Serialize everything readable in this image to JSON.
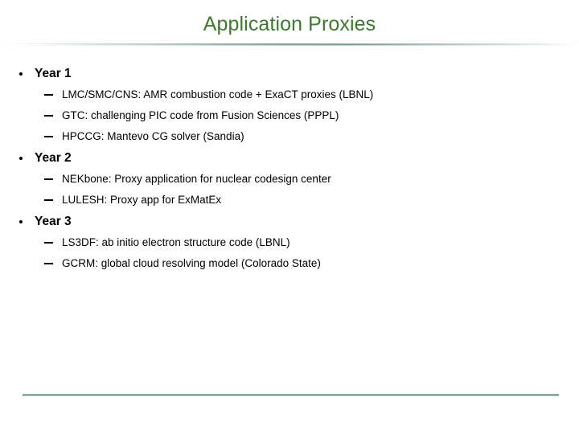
{
  "slide": {
    "title": "Application Proxies",
    "title_color": "#3C7A2E",
    "rule_color": "#3F6E63",
    "background_color": "#FFFFFF",
    "text_color": "#000000"
  },
  "content": {
    "groups": [
      {
        "heading": "Year 1",
        "items": [
          "LMC/SMC/CNS: AMR combustion code + ExaCT proxies (LBNL)",
          "GTC: challenging PIC code from Fusion Sciences (PPPL)",
          "HPCCG: Mantevo CG solver (Sandia)"
        ]
      },
      {
        "heading": "Year 2",
        "items": [
          "NEKbone: Proxy application for nuclear codesign center",
          "LULESH: Proxy app for ExMatEx"
        ]
      },
      {
        "heading": "Year 3",
        "items": [
          "LS3DF: ab initio electron structure code (LBNL)",
          "GCRM: global cloud resolving model (Colorado State)"
        ]
      }
    ]
  }
}
